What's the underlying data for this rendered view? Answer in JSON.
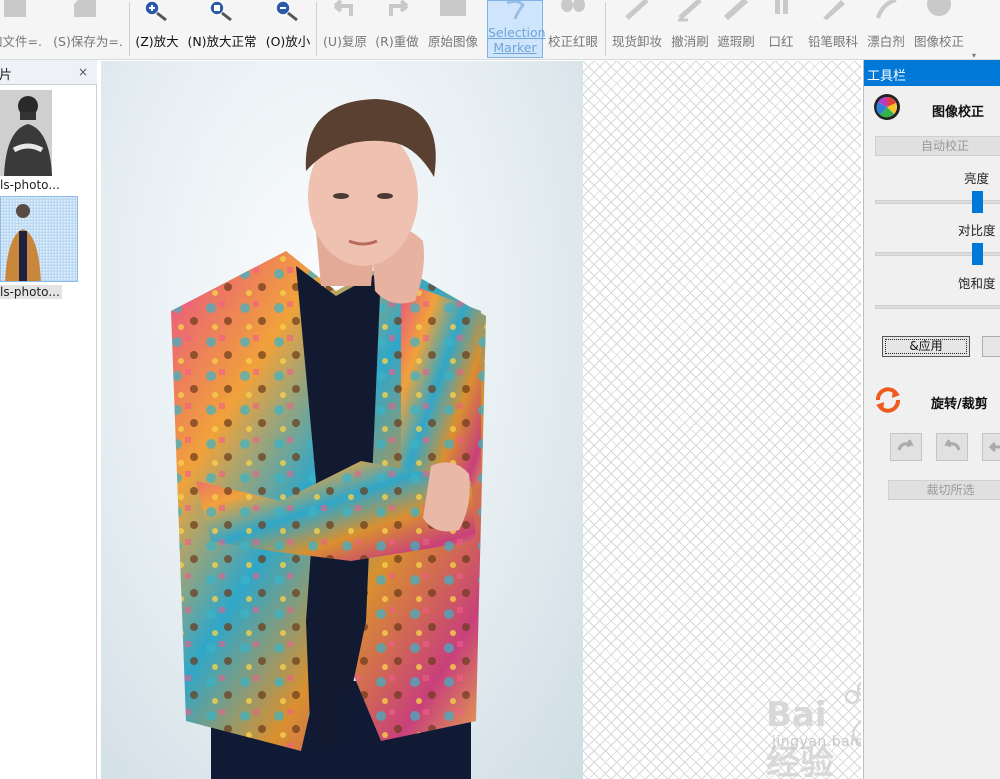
{
  "toolbar": {
    "buttons": [
      {
        "id": "open",
        "label": "加文件=.",
        "icon": "file-icon"
      },
      {
        "id": "saveas",
        "label": "(S)保存为=.",
        "icon": "save-icon"
      },
      {
        "id": "zoomin",
        "label": "(Z)放大",
        "icon": "zoom-in-icon"
      },
      {
        "id": "zoomnormal",
        "label": "(N)放大正常",
        "icon": "zoom-normal-icon"
      },
      {
        "id": "zoomout",
        "label": "(O)放小",
        "icon": "zoom-out-icon"
      },
      {
        "id": "undo",
        "label": "(U)复原",
        "icon": "undo-icon"
      },
      {
        "id": "redo",
        "label": "(R)重做",
        "icon": "redo-icon"
      },
      {
        "id": "original",
        "label": "原始图像",
        "icon": "original-image-icon"
      },
      {
        "id": "selection",
        "label": "Selection Marker",
        "icon": "lasso-icon"
      },
      {
        "id": "redeye",
        "label": "校正红眼",
        "icon": "red-eye-icon"
      },
      {
        "id": "makeup",
        "label": "现货卸妆",
        "icon": "makeup-remover-icon"
      },
      {
        "id": "undobrush",
        "label": "撤消刷",
        "icon": "undo-brush-icon"
      },
      {
        "id": "concealer",
        "label": "遮瑕刷",
        "icon": "concealer-brush-icon"
      },
      {
        "id": "lipstick",
        "label": "口红",
        "icon": "lipstick-icon"
      },
      {
        "id": "eyeliner",
        "label": "铅笔眼科",
        "icon": "eyeliner-pencil-icon"
      },
      {
        "id": "whitening",
        "label": "漂白剂",
        "icon": "whitening-icon"
      },
      {
        "id": "correction",
        "label": "图像校正",
        "icon": "image-correction-icon"
      }
    ]
  },
  "left_panel": {
    "title": "片",
    "close": "×",
    "files": [
      {
        "name": "ls-photo...",
        "selected": false
      },
      {
        "name": "ls-photo...",
        "selected": true
      }
    ]
  },
  "watermark": {
    "text": "Bai 经验",
    "url": "jingyan.baidu.com"
  },
  "toolbox": {
    "title": "工具栏",
    "correction_section": {
      "title": "图像校正",
      "auto_button": "自动校正",
      "brightness_label": "亮度",
      "brightness_value": 0.8,
      "contrast_label": "对比度",
      "contrast_value": 0.8,
      "saturation_label": "饱和度",
      "apply_button": "&应用"
    },
    "rotate_section": {
      "title": "旋转/裁剪",
      "crop_button": "裁切所选"
    }
  },
  "colors": {
    "accent": "#0078d7",
    "selection_bg": "#cfe5fb",
    "selection_text": "#6fa4d8"
  }
}
